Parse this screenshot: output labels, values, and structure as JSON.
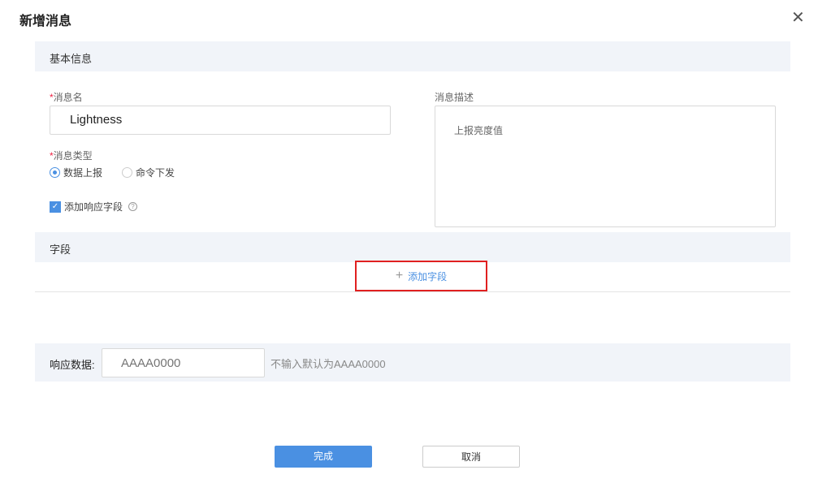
{
  "dialog": {
    "title": "新增消息",
    "close_icon": "close-icon"
  },
  "basic_section": {
    "title": "基本信息"
  },
  "message_name": {
    "label": "消息名",
    "required_mark": "*",
    "value": "Lightness"
  },
  "message_type": {
    "label": "消息类型",
    "required_mark": "*",
    "options": [
      {
        "label": "数据上报",
        "selected": true
      },
      {
        "label": "命令下发",
        "selected": false
      }
    ]
  },
  "add_response_field": {
    "label": "添加响应字段",
    "checked": true
  },
  "description": {
    "label": "消息描述",
    "value": "上报亮度值"
  },
  "fields_section": {
    "title": "字段",
    "add_label": "添加字段",
    "add_icon": "+"
  },
  "response_data": {
    "label": "响应数据:",
    "placeholder": "AAAA0000",
    "hint": "不输入默认为AAAA0000"
  },
  "footer": {
    "ok_label": "完成",
    "cancel_label": "取消"
  },
  "colors": {
    "primary": "#4a90e2",
    "highlight": "#e02020",
    "band": "#f1f4f9"
  }
}
